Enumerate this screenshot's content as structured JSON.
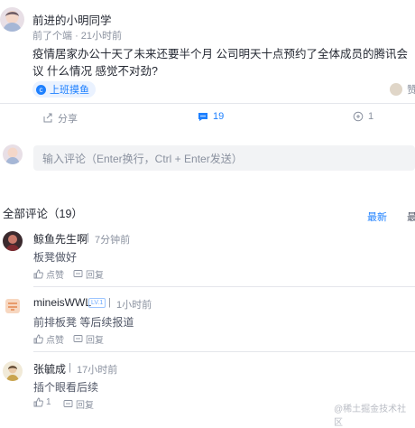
{
  "post": {
    "author": "前进的小明同学",
    "meta_time_prefix": "前了个端",
    "meta_time": "21小时前",
    "content": "疫情居家办公十天了未来还要半个月 公司明天十点预约了全体成员的腾讯会议 什么情况 感觉不对劲?",
    "tag": "上班摸鱼",
    "like_label": "赞",
    "actions": {
      "share": "分享",
      "comments": "19",
      "collect": "1"
    }
  },
  "comment_input": {
    "placeholder": "输入评论（Enter换行，Ctrl + Enter发送）"
  },
  "comments_header": {
    "title": "全部评论（19）",
    "sort_latest": "最新",
    "sort_hot": "最"
  },
  "comments": [
    {
      "name": "鲸鱼先生啊",
      "time": "7分钟前",
      "text": "板凳做好",
      "like": "点赞",
      "reply": "回复"
    },
    {
      "name": "mineisWWL",
      "level": "LV.1",
      "time": "1小时前",
      "text": "前排板凳 等后续报道",
      "like": "点赞",
      "reply": "回复"
    },
    {
      "name": "张毓成",
      "time": "17小时前",
      "text": "插个眼看后续",
      "like": "1",
      "reply": "回复"
    }
  ],
  "watermark": "@稀土掘金技术社区",
  "colors": {
    "accent": "#1e80ff",
    "muted": "#8a919f",
    "text": "#252933"
  }
}
